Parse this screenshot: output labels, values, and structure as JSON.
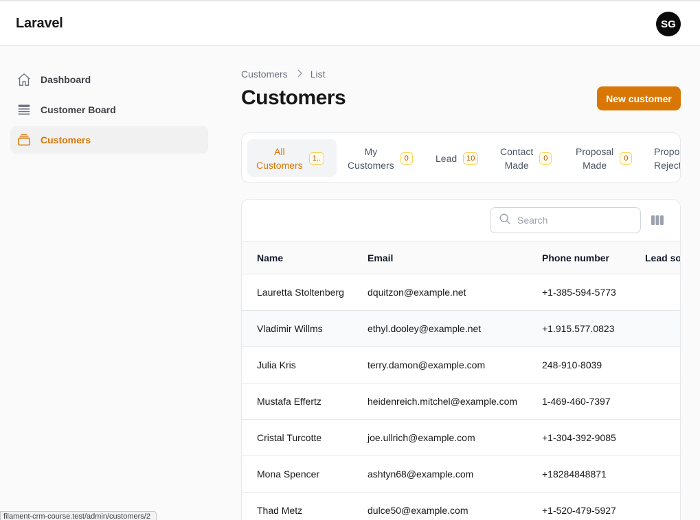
{
  "app": {
    "brand": "Laravel",
    "user_initials": "SG"
  },
  "sidebar": {
    "items": [
      {
        "label": "Dashboard",
        "icon": "home-icon"
      },
      {
        "label": "Customer Board",
        "icon": "board-icon"
      },
      {
        "label": "Customers",
        "icon": "inbox-stack-icon",
        "active": true
      }
    ]
  },
  "breadcrumb": {
    "first": "Customers",
    "second": "List"
  },
  "page": {
    "title": "Customers",
    "new_button": "New customer"
  },
  "tabs": [
    {
      "label_1": "All",
      "label_2": "Customers",
      "badge": "1..",
      "active": true
    },
    {
      "label_1": "My",
      "label_2": "Customers",
      "badge": "0"
    },
    {
      "label_1": "Lead",
      "label_2": "",
      "badge": "10"
    },
    {
      "label_1": "Contact",
      "label_2": "Made",
      "badge": "0"
    },
    {
      "label_1": "Proposal",
      "label_2": "Made",
      "badge": "0"
    },
    {
      "label_1": "Propo",
      "label_2": "Reject",
      "badge": ""
    }
  ],
  "table": {
    "search_placeholder": "Search",
    "columns": [
      "Name",
      "Email",
      "Phone number",
      "Lead so"
    ],
    "rows": [
      {
        "name": "Lauretta Stoltenberg",
        "email": "dquitzon@example.net",
        "phone": "+1-385-594-5773"
      },
      {
        "name": "Vladimir Willms",
        "email": "ethyl.dooley@example.net",
        "phone": "+1.915.577.0823"
      },
      {
        "name": "Julia Kris",
        "email": "terry.damon@example.com",
        "phone": "248-910-8039"
      },
      {
        "name": "Mustafa Effertz",
        "email": "heidenreich.mitchel@example.com",
        "phone": "1-469-460-7397"
      },
      {
        "name": "Cristal Turcotte",
        "email": "joe.ullrich@example.com",
        "phone": "+1-304-392-9085"
      },
      {
        "name": "Mona Spencer",
        "email": "ashtyn68@example.com",
        "phone": "+18284848871"
      },
      {
        "name": "Thad Metz",
        "email": "dulce50@example.com",
        "phone": "+1-520-479-5927"
      }
    ]
  },
  "status_bar": {
    "url": "filament-crm-course.test/admin/customers/2"
  },
  "colors": {
    "accent": "#d97706",
    "active_bg": "#f1f1f1"
  }
}
